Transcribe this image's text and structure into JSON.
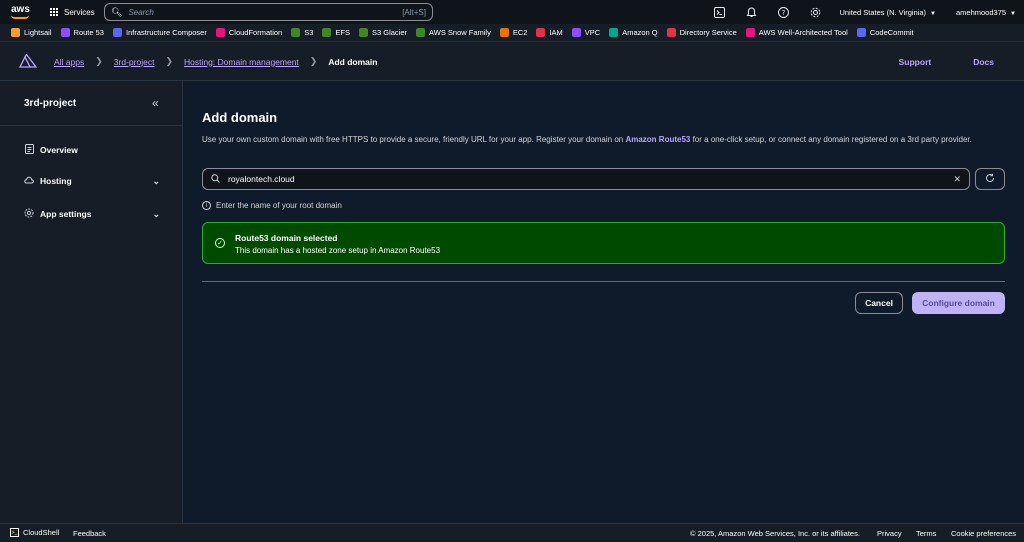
{
  "topnav": {
    "logo": "aws",
    "services_label": "Services",
    "search_placeholder": "Search",
    "search_shortcut": "[Alt+S]",
    "region": "United States (N. Virginia)",
    "user": "amehmood375"
  },
  "favorites": [
    {
      "label": "Lightsail",
      "color": "#f59b2f"
    },
    {
      "label": "Route 53",
      "color": "#8c4fff"
    },
    {
      "label": "Infrastructure Composer",
      "color": "#5a67f2"
    },
    {
      "label": "CloudFormation",
      "color": "#e7157b"
    },
    {
      "label": "S3",
      "color": "#3f8624"
    },
    {
      "label": "EFS",
      "color": "#3f8624"
    },
    {
      "label": "S3 Glacier",
      "color": "#3f8624"
    },
    {
      "label": "AWS Snow Family",
      "color": "#3f8624"
    },
    {
      "label": "EC2",
      "color": "#ed7100"
    },
    {
      "label": "IAM",
      "color": "#dd344c"
    },
    {
      "label": "VPC",
      "color": "#8c4fff"
    },
    {
      "label": "Amazon Q",
      "color": "#01a88d"
    },
    {
      "label": "Directory Service",
      "color": "#dd344c"
    },
    {
      "label": "AWS Well-Architected Tool",
      "color": "#e7157b"
    },
    {
      "label": "CodeCommit",
      "color": "#5a67f2"
    }
  ],
  "breadcrumb": {
    "all_apps": "All apps",
    "project": "3rd-project",
    "hosting": "Hosting: Domain management",
    "current": "Add domain"
  },
  "app_links": {
    "support": "Support",
    "docs": "Docs"
  },
  "sidebar": {
    "title": "3rd-project",
    "items": [
      {
        "label": "Overview"
      },
      {
        "label": "Hosting"
      },
      {
        "label": "App settings"
      }
    ]
  },
  "main": {
    "title": "Add domain",
    "desc_before": "Use your own custom domain with free HTTPS to provide a secure, friendly URL for your app. Register your domain on ",
    "desc_link": "Amazon Route53",
    "desc_after": " for a one-click setup, or connect any domain registered on a 3rd party provider.",
    "domain_value": "royalontech.cloud",
    "hint": "Enter the name of your root domain",
    "alert_title": "Route53 domain selected",
    "alert_desc": "This domain has a hosted zone setup in Amazon Route53",
    "cancel_label": "Cancel",
    "configure_label": "Configure domain"
  },
  "footer": {
    "cloudshell": "CloudShell",
    "feedback": "Feedback",
    "copyright": "© 2025, Amazon Web Services, Inc. or its affiliates.",
    "privacy": "Privacy",
    "terms": "Terms",
    "cookie": "Cookie preferences"
  }
}
